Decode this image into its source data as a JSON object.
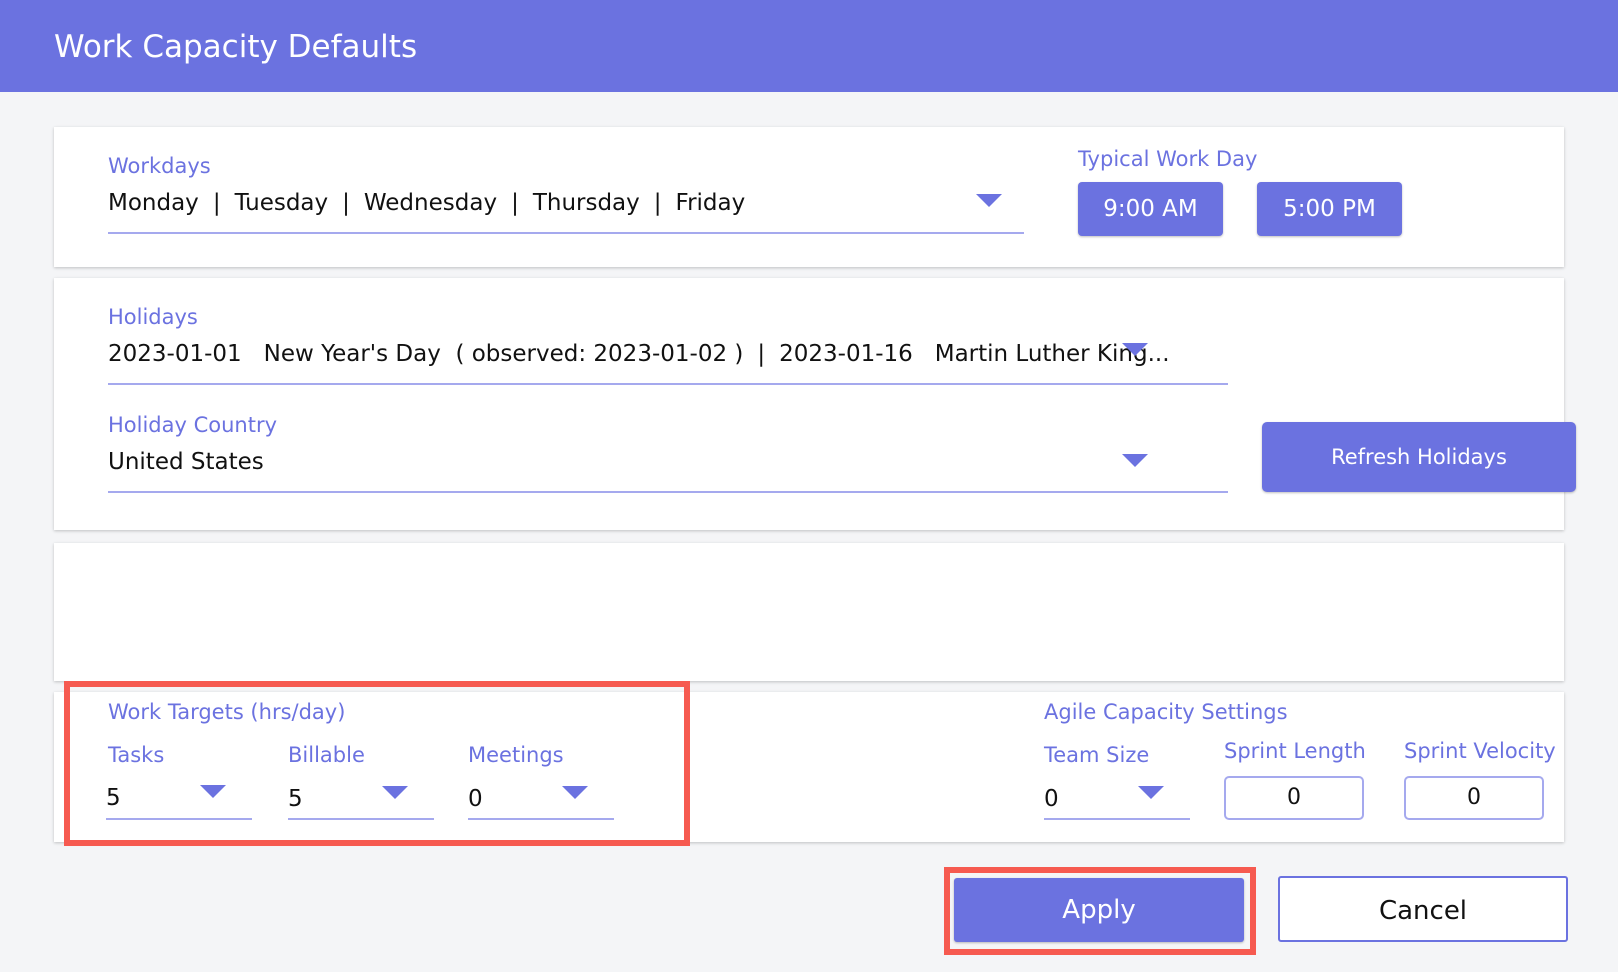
{
  "header": {
    "title": "Work Capacity Defaults"
  },
  "workdays": {
    "label": "Workdays",
    "days": [
      "Monday",
      "Tuesday",
      "Wednesday",
      "Thursday",
      "Friday"
    ],
    "separator": "|"
  },
  "typical_work_day": {
    "label": "Typical Work Day",
    "start": "9:00 AM",
    "end": "5:00 PM"
  },
  "holidays": {
    "label": "Holidays",
    "first_date": "2023-01-01",
    "first_name": "New Year's Day",
    "first_observed": "( observed: 2023-01-02 )",
    "separator": "|",
    "second_date": "2023-01-16",
    "second_name": "Martin Luther King..."
  },
  "holiday_country": {
    "label": "Holiday Country",
    "value": "United States",
    "refresh_label": "Refresh Holidays"
  },
  "work_targets": {
    "label": "Work Targets (hrs/day)",
    "tasks_label": "Tasks",
    "tasks_value": "5",
    "billable_label": "Billable",
    "billable_value": "5",
    "meetings_label": "Meetings",
    "meetings_value": "0"
  },
  "agile": {
    "label": "Agile Capacity Settings",
    "team_size_label": "Team Size",
    "team_size_value": "0",
    "sprint_length_label": "Sprint Length",
    "sprint_length_value": "0",
    "sprint_velocity_label": "Sprint Velocity",
    "sprint_velocity_value": "0"
  },
  "footer": {
    "apply_label": "Apply",
    "cancel_label": "Cancel"
  },
  "colors": {
    "accent": "#6b72e0",
    "highlight": "#f65a50",
    "underline": "#a5a9ee"
  }
}
